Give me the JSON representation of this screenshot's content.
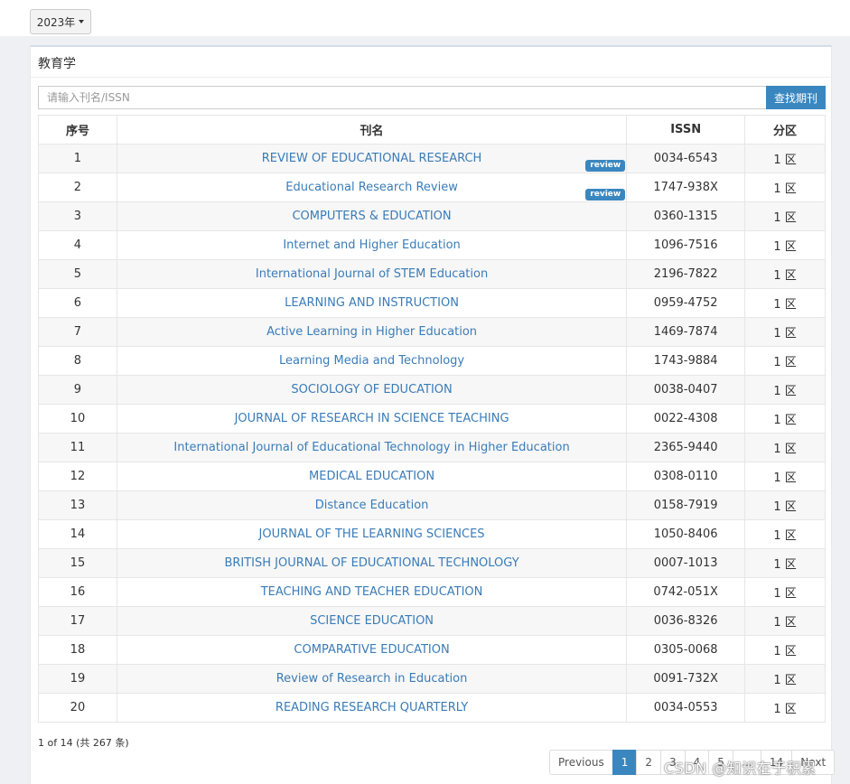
{
  "year_dropdown": {
    "label": "2023年"
  },
  "panel": {
    "title": "教育学"
  },
  "search": {
    "placeholder": "请输入刊名/ISSN",
    "button_label": "查找期刊"
  },
  "table": {
    "headers": [
      "序号",
      "刊名",
      "ISSN",
      "分区"
    ],
    "badge_label": "review",
    "rows": [
      {
        "no": "1",
        "name": "REVIEW OF EDUCATIONAL RESEARCH",
        "issn": "0034-6543",
        "zone": "1 区",
        "badge": true
      },
      {
        "no": "2",
        "name": "Educational Research Review",
        "issn": "1747-938X",
        "zone": "1 区",
        "badge": true
      },
      {
        "no": "3",
        "name": "COMPUTERS & EDUCATION",
        "issn": "0360-1315",
        "zone": "1 区"
      },
      {
        "no": "4",
        "name": "Internet and Higher Education",
        "issn": "1096-7516",
        "zone": "1 区"
      },
      {
        "no": "5",
        "name": "International Journal of STEM Education",
        "issn": "2196-7822",
        "zone": "1 区"
      },
      {
        "no": "6",
        "name": "LEARNING AND INSTRUCTION",
        "issn": "0959-4752",
        "zone": "1 区"
      },
      {
        "no": "7",
        "name": "Active Learning in Higher Education",
        "issn": "1469-7874",
        "zone": "1 区"
      },
      {
        "no": "8",
        "name": "Learning Media and Technology",
        "issn": "1743-9884",
        "zone": "1 区"
      },
      {
        "no": "9",
        "name": "SOCIOLOGY OF EDUCATION",
        "issn": "0038-0407",
        "zone": "1 区"
      },
      {
        "no": "10",
        "name": "JOURNAL OF RESEARCH IN SCIENCE TEACHING",
        "issn": "0022-4308",
        "zone": "1 区"
      },
      {
        "no": "11",
        "name": "International Journal of Educational Technology in Higher Education",
        "issn": "2365-9440",
        "zone": "1 区"
      },
      {
        "no": "12",
        "name": "MEDICAL EDUCATION",
        "issn": "0308-0110",
        "zone": "1 区"
      },
      {
        "no": "13",
        "name": "Distance Education",
        "issn": "0158-7919",
        "zone": "1 区"
      },
      {
        "no": "14",
        "name": "JOURNAL OF THE LEARNING SCIENCES",
        "issn": "1050-8406",
        "zone": "1 区"
      },
      {
        "no": "15",
        "name": "BRITISH JOURNAL OF EDUCATIONAL TECHNOLOGY",
        "issn": "0007-1013",
        "zone": "1 区"
      },
      {
        "no": "16",
        "name": "TEACHING AND TEACHER EDUCATION",
        "issn": "0742-051X",
        "zone": "1 区"
      },
      {
        "no": "17",
        "name": "SCIENCE EDUCATION",
        "issn": "0036-8326",
        "zone": "1 区"
      },
      {
        "no": "18",
        "name": "COMPARATIVE EDUCATION",
        "issn": "0305-0068",
        "zone": "1 区"
      },
      {
        "no": "19",
        "name": "Review of Research in Education",
        "issn": "0091-732X",
        "zone": "1 区"
      },
      {
        "no": "20",
        "name": "READING RESEARCH QUARTERLY",
        "issn": "0034-0553",
        "zone": "1 区"
      }
    ]
  },
  "footer": {
    "info": "1 of 14 (共 267 条)"
  },
  "pagination": {
    "previous": "Previous",
    "pages": [
      "1",
      "2",
      "3",
      "4",
      "5",
      "…",
      "14"
    ],
    "active": "1",
    "next": "Next"
  },
  "watermark": "CSDN @知识在于积累",
  "colors": {
    "accent": "#3a87c0",
    "link": "#3a7cb8"
  }
}
